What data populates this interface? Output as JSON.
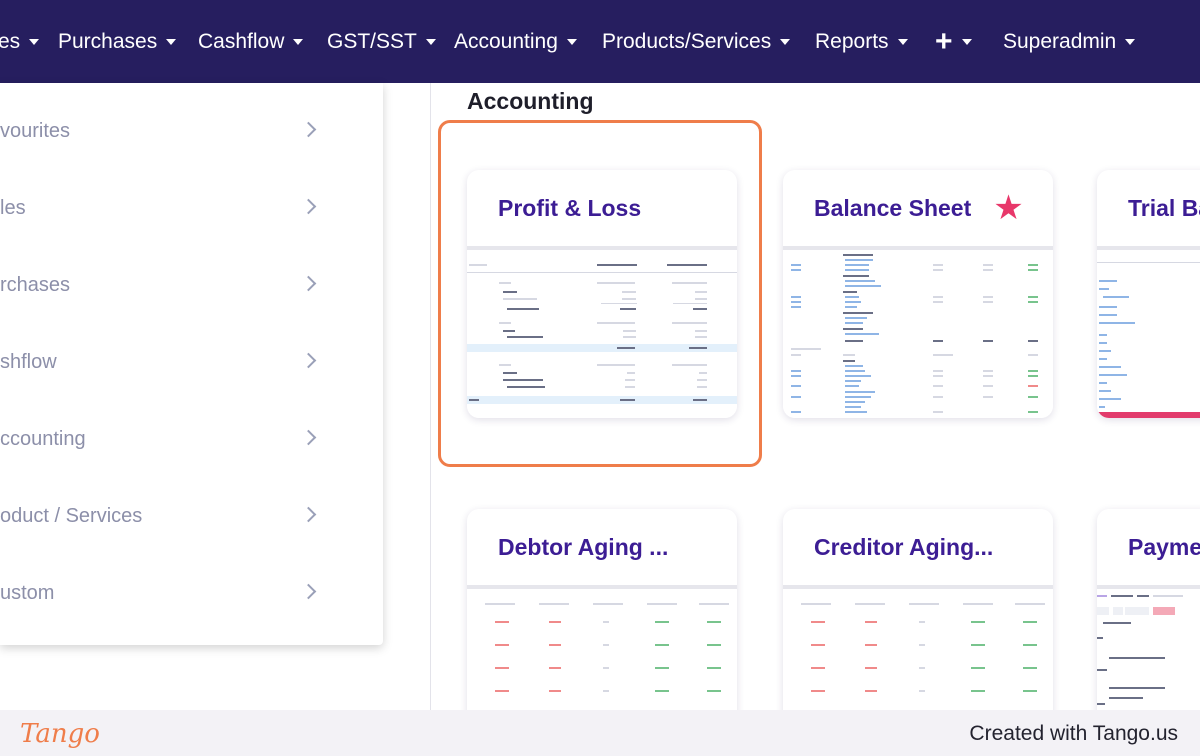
{
  "nav": {
    "items": [
      {
        "label": "es"
      },
      {
        "label": "Purchases"
      },
      {
        "label": "Cashflow"
      },
      {
        "label": "GST/SST"
      },
      {
        "label": "Accounting"
      },
      {
        "label": "Products/Services"
      },
      {
        "label": "Reports"
      },
      {
        "label": "+"
      },
      {
        "label": "Superadmin"
      }
    ]
  },
  "menu": {
    "items": [
      {
        "label": "vourites"
      },
      {
        "label": "les"
      },
      {
        "label": "rchases"
      },
      {
        "label": "shflow"
      },
      {
        "label": "ccounting"
      },
      {
        "label": "oduct / Services"
      },
      {
        "label": "ustom"
      }
    ]
  },
  "section": {
    "title": "Accounting"
  },
  "cards": [
    {
      "title": "Profit & Loss",
      "highlighted": true
    },
    {
      "title": "Balance Sheet",
      "starred": true,
      "star": "★"
    },
    {
      "title": "Trial Ba"
    },
    {
      "title": "Debtor Aging ..."
    },
    {
      "title": "Creditor Aging..."
    },
    {
      "title": "Payme"
    }
  ],
  "footer": {
    "logo": "Tango",
    "credit": "Created with Tango.us"
  },
  "colors": {
    "nav_bg": "#261e5f",
    "card_title": "#3c1d94",
    "highlight": "#ef7d4a",
    "star": "#e8376a"
  }
}
